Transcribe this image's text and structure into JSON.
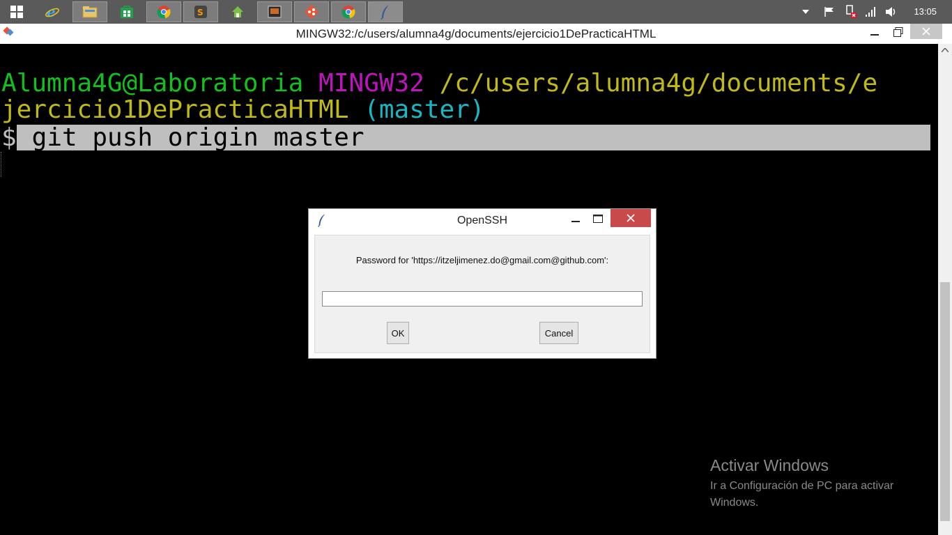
{
  "taskbar": {
    "apps": [
      {
        "name": "internet-explorer-icon"
      },
      {
        "name": "file-explorer-icon"
      },
      {
        "name": "store-icon"
      },
      {
        "name": "chrome-icon"
      },
      {
        "name": "sublime-icon"
      },
      {
        "name": "home-app-icon"
      },
      {
        "name": "media-icon"
      },
      {
        "name": "git-gui-icon"
      },
      {
        "name": "chrome-alt-icon"
      },
      {
        "name": "feather-icon"
      }
    ],
    "clock": "13:05"
  },
  "terminal_window": {
    "title": "MINGW32:/c/users/alumna4g/documents/ejercicio1DePracticaHTML",
    "prompt_user": "Alumna4G@Laboratoria",
    "prompt_system": "MINGW32",
    "prompt_path_1": "/c/users/alumna4g/documents/e",
    "prompt_path_2": "jercicio1DePracticaHTML",
    "prompt_branch": "(master)",
    "dollar": "$",
    "command": " git push origin master",
    "colors": {
      "user": "#11c11d",
      "system": "#c013c0",
      "path": "#c1b914",
      "branch": "#18b7c4"
    }
  },
  "dialog": {
    "title": "OpenSSH",
    "prompt": "Password for 'https://itzeljimenez.do@gmail.com@github.com':",
    "password_value": "",
    "ok_label": "OK",
    "cancel_label": "Cancel",
    "close_color": "#c94a4a"
  },
  "watermark": {
    "title": "Activar Windows",
    "subtitle": "Ir a Configuración de PC para activar Windows."
  }
}
